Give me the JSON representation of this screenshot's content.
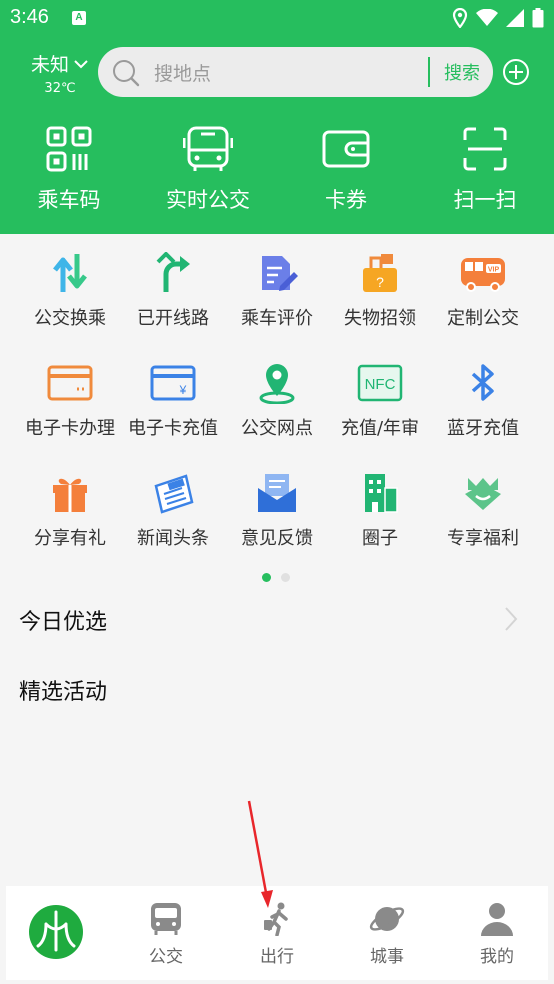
{
  "status": {
    "time": "3:46",
    "badge": "A"
  },
  "header": {
    "city": "未知",
    "temperature": "32℃",
    "search_placeholder": "搜地点",
    "search_button": "搜索"
  },
  "top_actions": [
    {
      "label": "乘车码",
      "icon": "qr-code-icon"
    },
    {
      "label": "实时公交",
      "icon": "bus-front-icon"
    },
    {
      "label": "卡券",
      "icon": "wallet-icon"
    },
    {
      "label": "扫一扫",
      "icon": "scan-icon"
    }
  ],
  "services": [
    {
      "label": "公交换乘",
      "icon": "transfer-icon"
    },
    {
      "label": "已开线路",
      "icon": "route-icon"
    },
    {
      "label": "乘车评价",
      "icon": "review-icon"
    },
    {
      "label": "失物招领",
      "icon": "lost-found-icon"
    },
    {
      "label": "定制公交",
      "icon": "vip-bus-icon"
    },
    {
      "label": "电子卡办理",
      "icon": "card-icon"
    },
    {
      "label": "电子卡充值",
      "icon": "card-recharge-icon"
    },
    {
      "label": "公交网点",
      "icon": "location-pin-icon"
    },
    {
      "label": "充值/年审",
      "icon": "nfc-icon"
    },
    {
      "label": "蓝牙充值",
      "icon": "bluetooth-icon"
    },
    {
      "label": "分享有礼",
      "icon": "gift-icon"
    },
    {
      "label": "新闻头条",
      "icon": "news-icon"
    },
    {
      "label": "意见反馈",
      "icon": "feedback-mail-icon"
    },
    {
      "label": "圈子",
      "icon": "building-icon"
    },
    {
      "label": "专享福利",
      "icon": "crown-icon"
    }
  ],
  "page_indicator": {
    "current": 1,
    "total": 2
  },
  "sections": {
    "today": "今日优选",
    "activities": "精选活动"
  },
  "tabbar": [
    {
      "label": "",
      "icon": "home-logo-icon"
    },
    {
      "label": "公交",
      "icon": "bus-icon"
    },
    {
      "label": "出行",
      "icon": "travel-walk-icon"
    },
    {
      "label": "城事",
      "icon": "planet-icon"
    },
    {
      "label": "我的",
      "icon": "user-icon"
    }
  ],
  "colors": {
    "brand": "#26be5e",
    "orange": "#f08a3c",
    "blue": "#3b82e6",
    "annotation": "#e8262b"
  }
}
